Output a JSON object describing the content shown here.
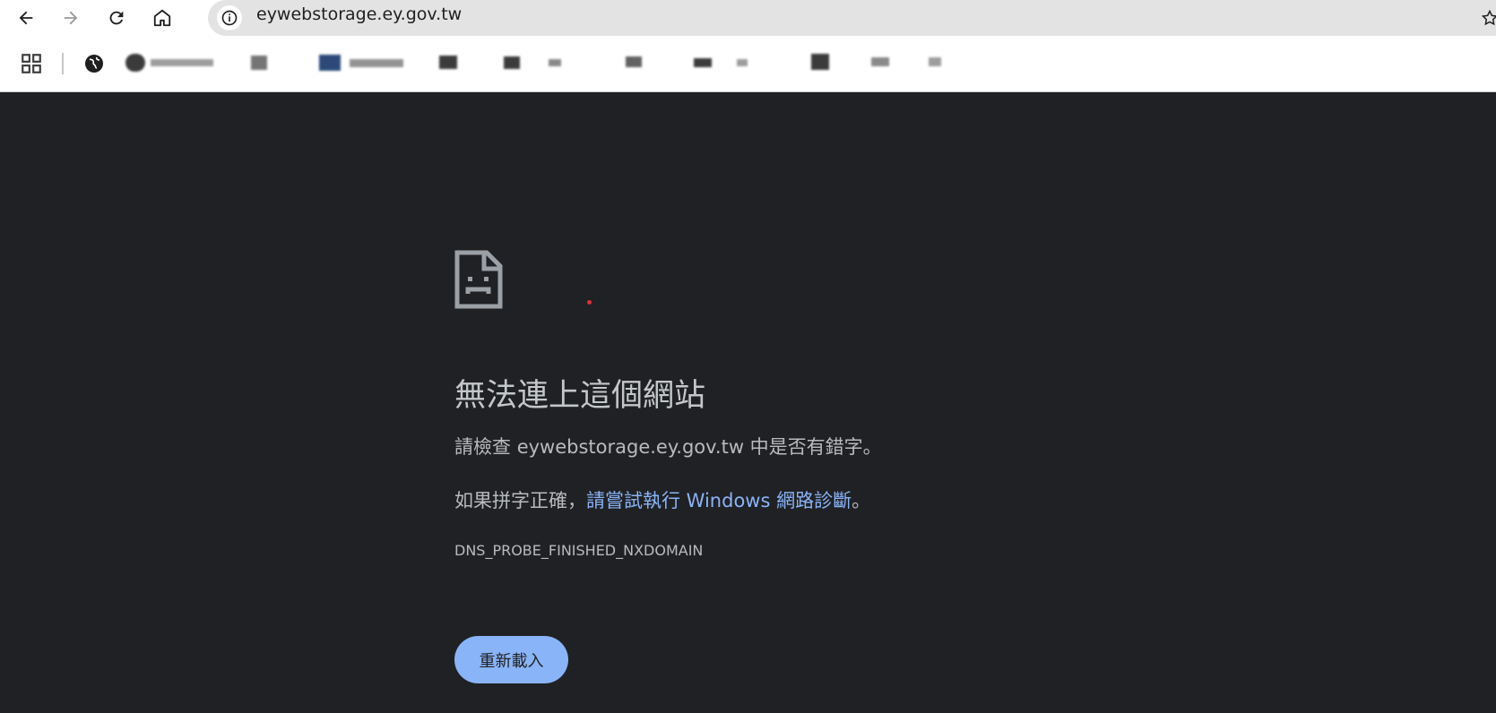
{
  "browser": {
    "url": "eywebstorage.ey.gov.tw",
    "icons": {
      "back": "arrow-left-icon",
      "forward": "arrow-right-icon",
      "reload": "reload-icon",
      "home": "home-icon",
      "site_info": "info-icon",
      "bookmark_star": "star-icon"
    }
  },
  "bookmarks_bar": {
    "icons": [
      "apps-grid-icon",
      "globe-icon"
    ],
    "note_blurred_items": 11
  },
  "error_page": {
    "title": "無法連上這個網站",
    "check_prefix": "請檢查 ",
    "check_host": "eywebstorage.ey.gov.tw",
    "check_suffix": " 中是否有錯字。",
    "spelling_prefix": "如果拼字正確，",
    "diagnostics_link": "請嘗試執行 Windows 網路診斷",
    "spelling_suffix": "。",
    "error_code": "DNS_PROBE_FINISHED_NXDOMAIN",
    "reload_label": "重新載入"
  },
  "colors": {
    "page_background": "#202124",
    "link": "#8ab4f8",
    "button": "#8ab4f8",
    "text": "#b8bbbe"
  }
}
